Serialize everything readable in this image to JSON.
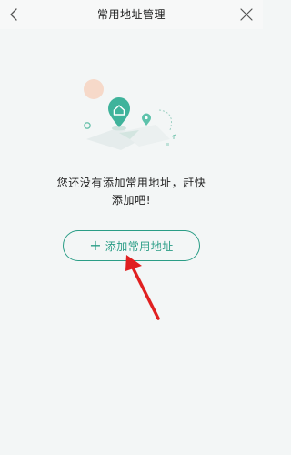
{
  "header": {
    "title": "常用地址管理",
    "back_icon": "chevron-left-icon",
    "close_icon": "close-icon"
  },
  "illustration": {
    "icon": "home-location-pin-illustration",
    "accent_color": "#34b59c"
  },
  "empty_state": {
    "message": "您还没有添加常用地址，赶快\n添加吧!"
  },
  "add_button": {
    "plus": "+",
    "label": "添加常用地址",
    "color": "#2a9d86"
  },
  "annotation": {
    "icon": "red-arrow-icon",
    "color": "#e02020"
  }
}
